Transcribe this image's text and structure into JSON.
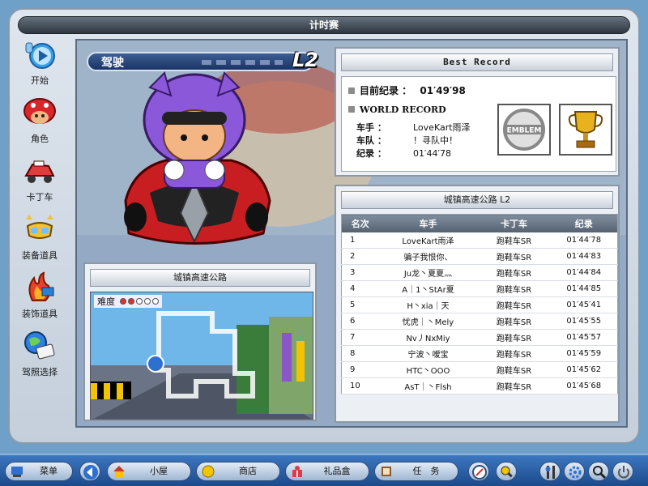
{
  "window": {
    "title": "计时赛"
  },
  "sidebar": {
    "items": [
      {
        "label": "开始",
        "icon": "play-icon"
      },
      {
        "label": "角色",
        "icon": "character-icon"
      },
      {
        "label": "卡丁车",
        "icon": "kart-icon"
      },
      {
        "label": "装备道具",
        "icon": "equipment-icon"
      },
      {
        "label": "装饰道具",
        "icon": "decoration-icon"
      },
      {
        "label": "驾照选择",
        "icon": "license-icon"
      }
    ]
  },
  "driver": {
    "label": "驾驶",
    "level": "L2"
  },
  "best_record": {
    "header": "Best Record",
    "current_label": "目前纪录 ：",
    "current_time": "01′49′98",
    "world_label": "WORLD RECORD",
    "driver_key": "车手  ：",
    "driver_value": "LoveKart雨泽",
    "team_key": "车队  ：",
    "team_value": "！寻队中！",
    "record_key": "纪录  ：",
    "record_value": "01′44′78",
    "emblem_text": "EMBLEM"
  },
  "ranking": {
    "title": "城镇高速公路 L2",
    "columns": [
      "名次",
      "车手",
      "卡丁车",
      "纪录"
    ],
    "rows": [
      [
        "1",
        "LoveKart雨泽",
        "跑鞋车SR",
        "01′44′78"
      ],
      [
        "2",
        "骗子我恨你、",
        "跑鞋车SR",
        "01′44′83"
      ],
      [
        "3",
        "Ju龙丶夏夏灬",
        "跑鞋车SR",
        "01′44′84"
      ],
      [
        "4",
        "A｜1丶StAr夏",
        "跑鞋车SR",
        "01′44′85"
      ],
      [
        "5",
        "H丶xia｜天",
        "跑鞋车SR",
        "01′45′41"
      ],
      [
        "6",
        "忧虎｜丶Mely",
        "跑鞋车SR",
        "01′45′55"
      ],
      [
        "7",
        "Nv丿NxMiy",
        "跑鞋车SR",
        "01′45′57"
      ],
      [
        "8",
        "宁波丶嗳宝",
        "跑鞋车SR",
        "01′45′59"
      ],
      [
        "9",
        "HTC丶OOO",
        "跑鞋车SR",
        "01′45′62"
      ],
      [
        "10",
        "AsT｜丶Flsh",
        "跑鞋车SR",
        "01′45′68"
      ]
    ]
  },
  "track": {
    "title": "城镇高速公路",
    "difficulty_label": "难度",
    "difficulty_level": 2,
    "difficulty_max": 5
  },
  "taskbar": {
    "menu": "菜单",
    "home": "小屋",
    "shop": "商店",
    "gift": "礼品盒",
    "mission": "任　务"
  },
  "colors": {
    "dot_on": "#e03030",
    "dot_off": "#ffffff"
  }
}
